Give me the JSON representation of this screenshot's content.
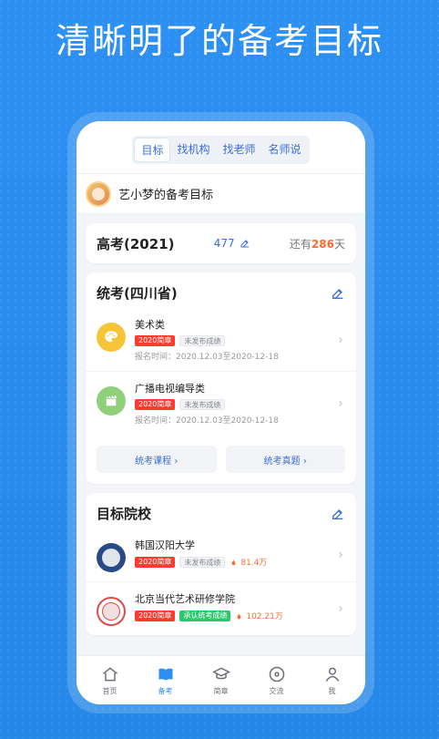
{
  "banner": {
    "headline": "清晰明了的备考目标"
  },
  "app": {
    "tabs": [
      {
        "label": "目标"
      },
      {
        "label": "找机构"
      },
      {
        "label": "找老师"
      },
      {
        "label": "名师说"
      }
    ],
    "user": {
      "title": "艺小梦的备考目标"
    },
    "gaokao": {
      "title": "高考(2021)",
      "score": "477",
      "remain_prefix": "还有",
      "remain_days": "286",
      "remain_suffix": "天"
    },
    "tongkao": {
      "title": "统考(四川省)",
      "items": [
        {
          "name": "美术类",
          "tag1": "2020简章",
          "tag2": "未发布成绩",
          "date": "报名时间：2020.12.03至2020-12-18"
        },
        {
          "name": "广播电视编导类",
          "tag1": "2020简章",
          "tag2": "未发布成绩",
          "date": "报名时间：2020.12.03至2020-12-18"
        }
      ],
      "buttons": {
        "courses": "统考课程 ›",
        "questions": "统考真题 ›"
      }
    },
    "target": {
      "title": "目标院校",
      "schools": [
        {
          "name": "韩国汉阳大学",
          "tag1": "2020简章",
          "tag2": "未发布成绩",
          "hot": "81.4万"
        },
        {
          "name": "北京当代艺术研修学院",
          "tag1": "2020简章",
          "tag2": "承认统考成绩",
          "hot": "102.21万"
        }
      ]
    },
    "nav": [
      {
        "label": "首页",
        "icon": "home-icon"
      },
      {
        "label": "备考",
        "icon": "book-icon"
      },
      {
        "label": "简章",
        "icon": "graduation-cap-icon"
      },
      {
        "label": "交流",
        "icon": "chat-icon"
      },
      {
        "label": "我",
        "icon": "user-icon"
      }
    ],
    "colors": {
      "accent": "#2c8ff2",
      "tag_red": "#ff3b30",
      "tag_green": "#2bc86b",
      "orange": "#ff6b2e"
    }
  }
}
